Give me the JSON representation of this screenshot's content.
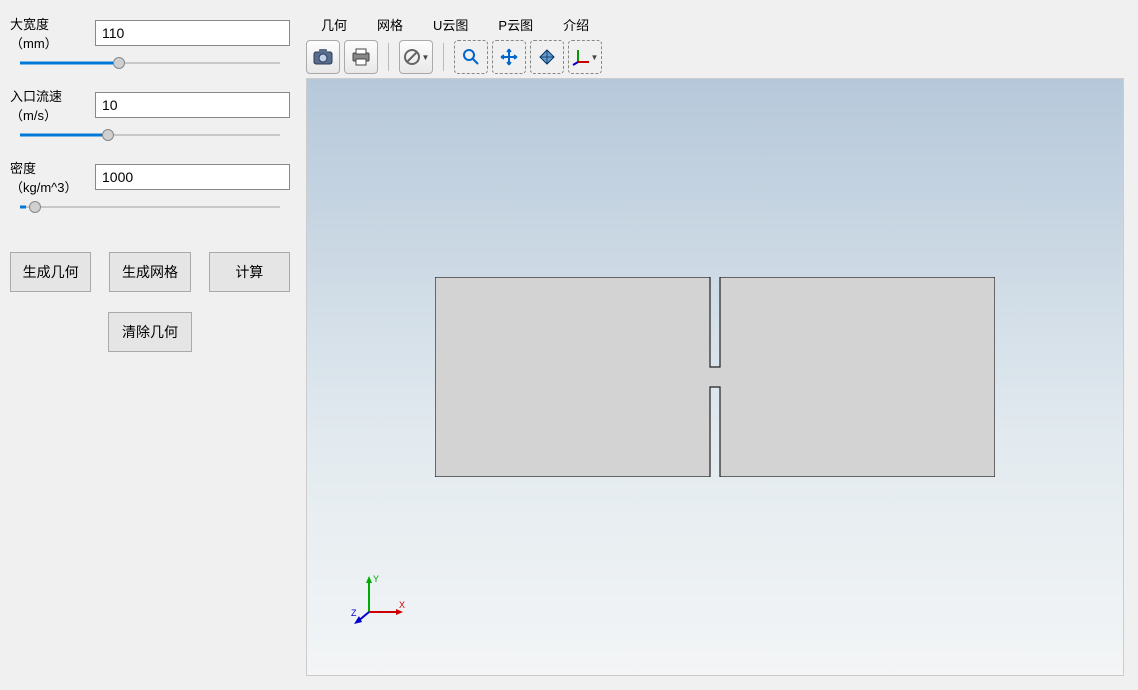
{
  "params": [
    {
      "label": "大宽度（mm）",
      "value": "110",
      "slider_fill": 34,
      "slider_thumb": 39
    },
    {
      "label": "入口流速（m/s）",
      "value": "10",
      "slider_fill": 30,
      "slider_thumb": 35
    },
    {
      "label": "密度（kg/m^3）",
      "value": "1000",
      "slider_fill": 2,
      "slider_thumb": 9
    }
  ],
  "buttons": {
    "gen_geom": "生成几何",
    "gen_mesh": "生成网格",
    "compute": "计算",
    "clear": "清除几何"
  },
  "tabs": [
    "几何",
    "网格",
    "U云图",
    "P云图",
    "介绍"
  ],
  "active_tab": 0,
  "triad": {
    "x": "X",
    "y": "Y",
    "z": "Z"
  },
  "icons": {
    "camera": "camera-icon",
    "print": "print-icon",
    "forbid": "forbid-icon",
    "zoom": "zoom-icon",
    "move": "move-icon",
    "rotate": "rotate-icon",
    "axes": "axes-icon"
  }
}
